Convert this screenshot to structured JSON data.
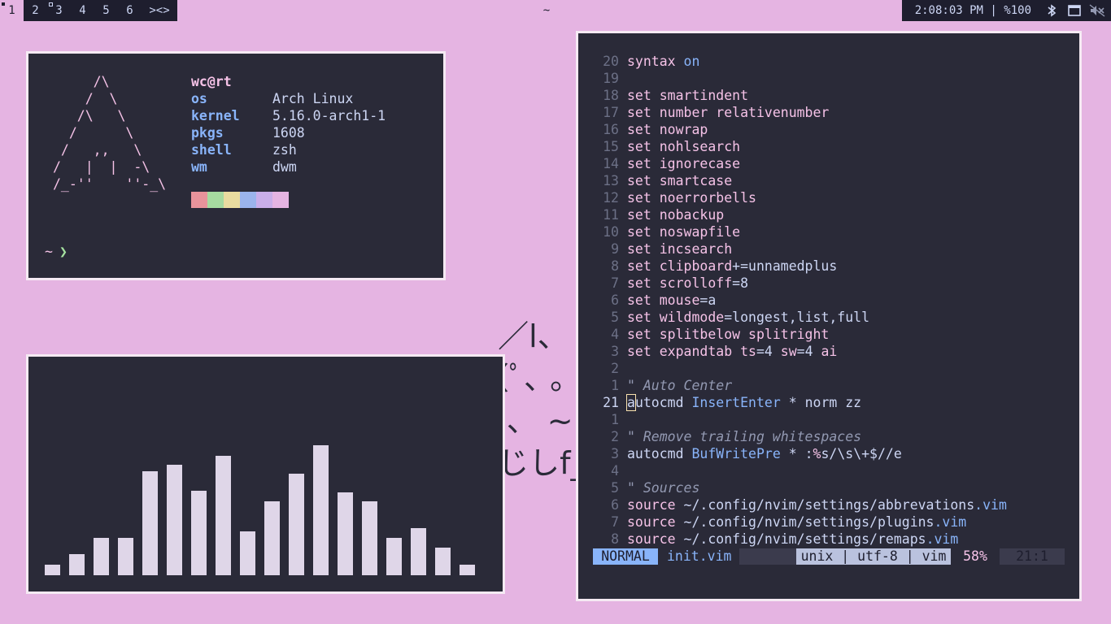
{
  "topbar": {
    "tags": [
      "1",
      "2",
      "3",
      "4",
      "5",
      "6"
    ],
    "layout": "><>",
    "title": "~",
    "status": "2:08:03 PM | %100",
    "tray": [
      "bluetooth-icon",
      "window-icon",
      "muted-speaker-icon"
    ]
  },
  "fetch": {
    "logo": "     /\\\n    /  \\\n   /\\   \\\n  /      \\\n /   ,,   \\\n/   |  |  -\\\n/_-''    ''-_\\",
    "user": "wc@rt",
    "rows": [
      {
        "key": "os",
        "value": "Arch Linux"
      },
      {
        "key": "kernel",
        "value": "5.16.0-arch1-1"
      },
      {
        "key": "pkgs",
        "value": "1608"
      },
      {
        "key": "shell",
        "value": "zsh"
      },
      {
        "key": "wm",
        "value": "dwm"
      }
    ],
    "palette": [
      "#e8939b",
      "#a6dba0",
      "#e9dca0",
      "#9bb4ec",
      "#c9aee9",
      "#e5b4e2"
    ],
    "prompt_tilde": "~",
    "prompt_arrow": "❯"
  },
  "visualizer": {
    "levels": [
      0.08,
      0.16,
      0.29,
      0.29,
      0.8,
      0.85,
      0.65,
      0.92,
      0.34,
      0.57,
      0.78,
      1.0,
      0.64,
      0.57,
      0.29,
      0.36,
      0.21,
      0.08
    ]
  },
  "editor": {
    "lines": [
      {
        "n": "20",
        "parts": [
          [
            "syntax ",
            "kw"
          ],
          [
            "on",
            "kw2"
          ]
        ]
      },
      {
        "n": "19",
        "parts": []
      },
      {
        "n": "18",
        "parts": [
          [
            "set ",
            "kw"
          ],
          [
            "smartindent",
            "kw"
          ]
        ]
      },
      {
        "n": "17",
        "parts": [
          [
            "set ",
            "kw"
          ],
          [
            "number relativenumber",
            "kw"
          ]
        ]
      },
      {
        "n": "16",
        "parts": [
          [
            "set ",
            "kw"
          ],
          [
            "nowrap",
            "kw"
          ]
        ]
      },
      {
        "n": "15",
        "parts": [
          [
            "set ",
            "kw"
          ],
          [
            "nohlsearch",
            "kw"
          ]
        ]
      },
      {
        "n": "14",
        "parts": [
          [
            "set ",
            "kw"
          ],
          [
            "ignorecase",
            "kw"
          ]
        ]
      },
      {
        "n": "13",
        "parts": [
          [
            "set ",
            "kw"
          ],
          [
            "smartcase",
            "kw"
          ]
        ]
      },
      {
        "n": "12",
        "parts": [
          [
            "set ",
            "kw"
          ],
          [
            "noerrorbells",
            "kw"
          ]
        ]
      },
      {
        "n": "11",
        "parts": [
          [
            "set ",
            "kw"
          ],
          [
            "nobackup",
            "kw"
          ]
        ]
      },
      {
        "n": "10",
        "parts": [
          [
            "set ",
            "kw"
          ],
          [
            "noswapfile",
            "kw"
          ]
        ]
      },
      {
        "n": "9",
        "parts": [
          [
            "set ",
            "kw"
          ],
          [
            "incsearch",
            "kw"
          ]
        ]
      },
      {
        "n": "8",
        "parts": [
          [
            "set ",
            "kw"
          ],
          [
            "clipboard",
            "kw"
          ],
          [
            "+=unnamedplus",
            "code"
          ]
        ]
      },
      {
        "n": "7",
        "parts": [
          [
            "set ",
            "kw"
          ],
          [
            "scrolloff",
            "kw"
          ],
          [
            "=8",
            "code"
          ]
        ]
      },
      {
        "n": "6",
        "parts": [
          [
            "set ",
            "kw"
          ],
          [
            "mouse",
            "kw"
          ],
          [
            "=a",
            "code"
          ]
        ]
      },
      {
        "n": "5",
        "parts": [
          [
            "set ",
            "kw"
          ],
          [
            "wildmode",
            "kw"
          ],
          [
            "=longest,list,full",
            "code"
          ]
        ]
      },
      {
        "n": "4",
        "parts": [
          [
            "set ",
            "kw"
          ],
          [
            "splitbelow splitright",
            "kw"
          ]
        ]
      },
      {
        "n": "3",
        "parts": [
          [
            "set ",
            "kw"
          ],
          [
            "expandtab ts",
            "kw"
          ],
          [
            "=4 ",
            "code"
          ],
          [
            "sw",
            "kw"
          ],
          [
            "=4 ",
            "code"
          ],
          [
            "ai",
            "kw"
          ]
        ]
      },
      {
        "n": "2",
        "parts": []
      },
      {
        "n": "1",
        "parts": [
          [
            "\" Auto Center",
            "cm"
          ]
        ]
      },
      {
        "n": "21",
        "cur": true,
        "parts": [
          [
            "a",
            "cursor"
          ],
          [
            "utocmd ",
            "code"
          ],
          [
            "InsertEnter",
            "kw2"
          ],
          [
            " * ",
            "code"
          ],
          [
            "norm zz",
            "code"
          ]
        ]
      },
      {
        "n": "1",
        "parts": []
      },
      {
        "n": "2",
        "parts": [
          [
            "\" Remove trailing whitespaces",
            "cm"
          ]
        ]
      },
      {
        "n": "3",
        "parts": [
          [
            "autocmd ",
            "code"
          ],
          [
            "BufWritePre",
            "kw2"
          ],
          [
            " * :",
            "code"
          ],
          [
            "%",
            "kw"
          ],
          [
            "s/\\s\\+$//e",
            "code"
          ]
        ]
      },
      {
        "n": "4",
        "parts": []
      },
      {
        "n": "5",
        "parts": [
          [
            "\" Sources",
            "cm"
          ]
        ]
      },
      {
        "n": "6",
        "parts": [
          [
            "source ",
            "kw"
          ],
          [
            "~/.config/nvim/settings/abbrevations",
            "code"
          ],
          [
            ".vim",
            "kw2"
          ]
        ]
      },
      {
        "n": "7",
        "parts": [
          [
            "source ",
            "kw"
          ],
          [
            "~/.config/nvim/settings/plugins",
            "code"
          ],
          [
            ".vim",
            "kw2"
          ]
        ]
      },
      {
        "n": "8",
        "parts": [
          [
            "source ",
            "kw"
          ],
          [
            "~/.config/nvim/settings/remaps",
            "code"
          ],
          [
            ".vim",
            "kw2"
          ]
        ]
      }
    ],
    "statusline": {
      "mode": "NORMAL",
      "file": "init.vim",
      "format": "unix | utf-8 | vim",
      "percent": "58%",
      "position": "21:1"
    }
  },
  "wallpaper": {
    "kaomoji": "  ／l、\n（ﾟ､ 。７\n  l、 ~ヽ\n  じしf_, )ノ"
  }
}
